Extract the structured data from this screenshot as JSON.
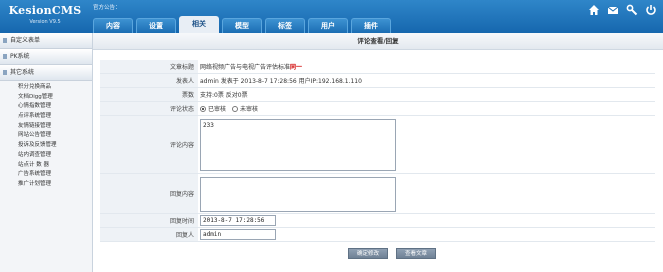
{
  "app": {
    "name": "KesionCMS",
    "version": "Version V9.5"
  },
  "header": {
    "notice": "官方公告：",
    "tabs": [
      {
        "label": "内容"
      },
      {
        "label": "设置"
      },
      {
        "label": "相关",
        "active": true
      },
      {
        "label": "模型"
      },
      {
        "label": "标签"
      },
      {
        "label": "用户"
      },
      {
        "label": "插件"
      }
    ],
    "icons": [
      "home-icon",
      "mail-icon",
      "tools-icon",
      "logout-icon"
    ]
  },
  "sidebar": {
    "sections": [
      {
        "label": "自定义表单"
      },
      {
        "label": "PK系统"
      },
      {
        "label": "其它系统"
      }
    ],
    "items": [
      "积分兑换商品",
      "文档Digg管理",
      "心情指数管理",
      "点评系统管理",
      "友情链接管理",
      "网站公告管理",
      "投诉及反馈管理",
      "站内调查管理",
      "站点计 数 器",
      "广告系统管理",
      "推广计划管理"
    ]
  },
  "main": {
    "page_title": "评论查看/回复",
    "form": {
      "article_title_label": "文章标题",
      "article_title": "网络视频广告与电视广告评估标准",
      "article_title_tag": "同一",
      "publisher_label": "发表人",
      "publisher": "admin 发表于 2013-8-7 17:28:56 用户IP:192.168.1.110",
      "votes_label": "票数",
      "votes": "支持:0票 反对0票",
      "status_label": "评论状态",
      "status_options": [
        "已审核",
        "未审核"
      ],
      "status_selected": "已审核",
      "content_label": "评论内容",
      "content": "233",
      "reply_label": "回复内容",
      "reply": "",
      "reply_time_label": "回复时间",
      "reply_time": "2013-8-7 17:28:56",
      "replier_label": "回复人",
      "replier": "admin"
    },
    "buttons": {
      "confirm": "确定修改",
      "view": "查看文章"
    }
  }
}
